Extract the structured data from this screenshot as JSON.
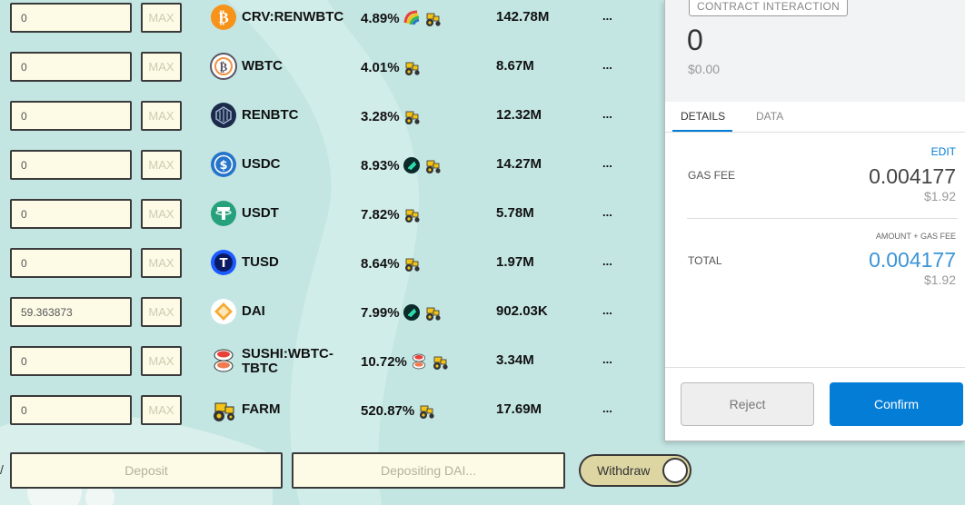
{
  "pools": [
    {
      "amount": "0",
      "max_label": "MAX",
      "icon": "crv-renwbtc-icon",
      "name": "CRV:RENWBTC",
      "apy": "4.89%",
      "badges": [
        "curve-rainbow-icon",
        "tractor-icon"
      ],
      "tvl": "142.78M",
      "more": "..."
    },
    {
      "amount": "0",
      "max_label": "MAX",
      "icon": "wbtc-icon",
      "name": "WBTC",
      "apy": "4.01%",
      "badges": [
        "tractor-icon"
      ],
      "tvl": "8.67M",
      "more": "..."
    },
    {
      "amount": "0",
      "max_label": "MAX",
      "icon": "renbtc-icon",
      "name": "RENBTC",
      "apy": "3.28%",
      "badges": [
        "tractor-icon"
      ],
      "tvl": "12.32M",
      "more": "..."
    },
    {
      "amount": "0",
      "max_label": "MAX",
      "icon": "usdc-icon",
      "name": "USDC",
      "apy": "8.93%",
      "badges": [
        "idle-icon",
        "tractor-icon"
      ],
      "tvl": "14.27M",
      "more": "..."
    },
    {
      "amount": "0",
      "max_label": "MAX",
      "icon": "usdt-icon",
      "name": "USDT",
      "apy": "7.82%",
      "badges": [
        "tractor-icon"
      ],
      "tvl": "5.78M",
      "more": "..."
    },
    {
      "amount": "0",
      "max_label": "MAX",
      "icon": "tusd-icon",
      "name": "TUSD",
      "apy": "8.64%",
      "badges": [
        "tractor-icon"
      ],
      "tvl": "1.97M",
      "more": "..."
    },
    {
      "amount": "59.363873",
      "max_label": "MAX",
      "icon": "dai-icon",
      "name": "DAI",
      "apy": "7.99%",
      "badges": [
        "idle-icon",
        "tractor-icon"
      ],
      "tvl": "902.03K",
      "more": "..."
    },
    {
      "amount": "0",
      "max_label": "MAX",
      "icon": "sushi-icon",
      "name": "SUSHI:WBTC-TBTC",
      "apy": "10.72%",
      "badges": [
        "sushi-icon",
        "tractor-icon"
      ],
      "tvl": "3.34M",
      "more": "..."
    },
    {
      "amount": "0",
      "max_label": "MAX",
      "icon": "farm-icon",
      "name": "FARM",
      "apy": "520.87%",
      "badges": [
        "tractor-icon"
      ],
      "tvl": "17.69M",
      "more": "..."
    }
  ],
  "actions": {
    "deposit": "Deposit",
    "depositing": "Depositing DAI...",
    "withdraw": "Withdraw"
  },
  "wallet": {
    "badge": "CONTRACT INTERACTION",
    "amount": "0",
    "amount_usd": "$0.00",
    "tabs": [
      "DETAILS",
      "DATA"
    ],
    "edit": "EDIT",
    "gas_fee_label": "GAS FEE",
    "gas_fee": "0.004177",
    "gas_fee_usd": "$1.92",
    "amount_gas_hint": "AMOUNT + GAS FEE",
    "total_label": "TOTAL",
    "total": "0.004177",
    "total_usd": "$1.92",
    "reject": "Reject",
    "confirm": "Confirm",
    "accent": "#037dd6"
  }
}
